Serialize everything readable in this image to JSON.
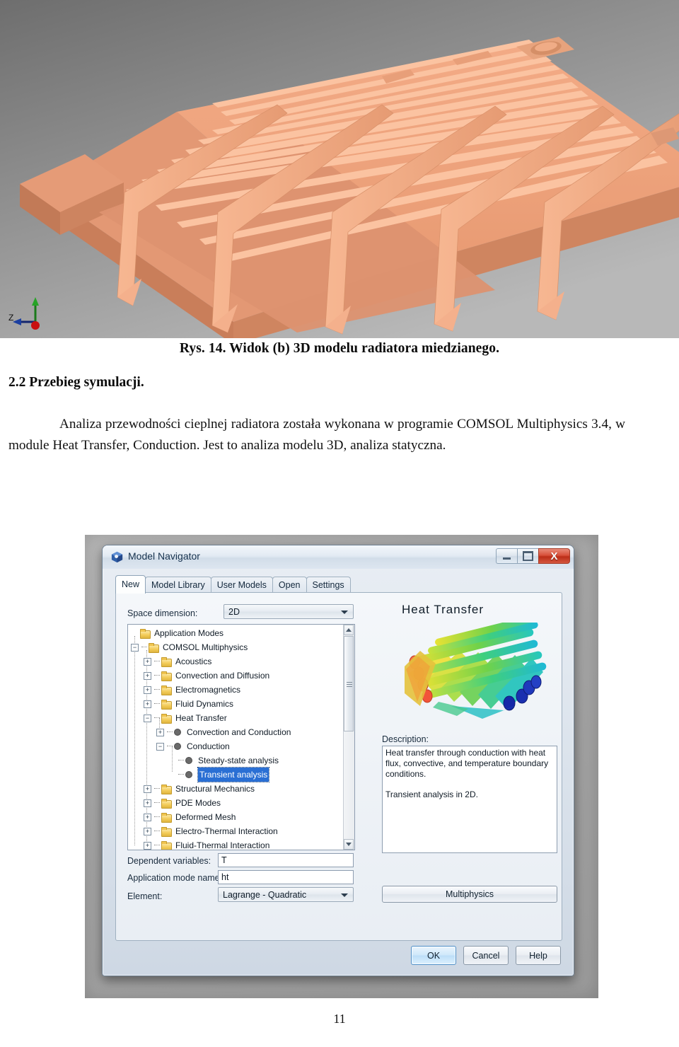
{
  "figure": {
    "alt": "3D model of a copper heatsink rendered in CAD, orange-copper colored, gray gradient background",
    "axis_labels": {
      "z": "Z"
    },
    "colors": {
      "body": "#e0906b",
      "top": "#f0a07a",
      "background_dark": "#6d6d6d",
      "background_light": "#b5b5b5"
    }
  },
  "document": {
    "figure_caption": "Rys. 14. Widok (b) 3D modelu radiatora miedzianego.",
    "section_heading": "2.2 Przebieg symulacji.",
    "paragraph": "Analiza przewodności cieplnej radiatora została wykonana w programie COMSOL Multiphysics 3.4, w module Heat Transfer, Conduction. Jest to analiza modelu 3D, analiza statyczna.",
    "page_number": "11"
  },
  "dialog": {
    "title": "Model Navigator",
    "window_buttons": {
      "minimize": "minimize",
      "maximize": "maximize",
      "close": "X"
    },
    "tabs": [
      {
        "label": "New",
        "active": true
      },
      {
        "label": "Model Library",
        "active": false
      },
      {
        "label": "User Models",
        "active": false
      },
      {
        "label": "Open",
        "active": false
      },
      {
        "label": "Settings",
        "active": false
      }
    ],
    "space_dimension": {
      "label": "Space dimension:",
      "value": "2D"
    },
    "tree": [
      {
        "label": "Application Modes",
        "depth": 0,
        "icon": "folder",
        "expander": "none",
        "selected": false
      },
      {
        "label": "COMSOL Multiphysics",
        "depth": 1,
        "icon": "folder",
        "expander": "minus",
        "selected": false
      },
      {
        "label": "Acoustics",
        "depth": 2,
        "icon": "folder",
        "expander": "plus",
        "selected": false
      },
      {
        "label": "Convection and Diffusion",
        "depth": 2,
        "icon": "folder",
        "expander": "plus",
        "selected": false
      },
      {
        "label": "Electromagnetics",
        "depth": 2,
        "icon": "folder",
        "expander": "plus",
        "selected": false
      },
      {
        "label": "Fluid Dynamics",
        "depth": 2,
        "icon": "folder",
        "expander": "plus",
        "selected": false
      },
      {
        "label": "Heat Transfer",
        "depth": 2,
        "icon": "folder",
        "expander": "minus",
        "selected": false
      },
      {
        "label": "Convection and Conduction",
        "depth": 3,
        "icon": "dot",
        "expander": "plus",
        "selected": false
      },
      {
        "label": "Conduction",
        "depth": 3,
        "icon": "dot",
        "expander": "minus",
        "selected": false
      },
      {
        "label": "Steady-state analysis",
        "depth": 4,
        "icon": "dot",
        "expander": "none",
        "selected": false
      },
      {
        "label": "Transient analysis",
        "depth": 4,
        "icon": "dot",
        "expander": "none",
        "selected": true
      },
      {
        "label": "Structural Mechanics",
        "depth": 2,
        "icon": "folder",
        "expander": "plus",
        "selected": false
      },
      {
        "label": "PDE Modes",
        "depth": 2,
        "icon": "folder",
        "expander": "plus",
        "selected": false
      },
      {
        "label": "Deformed Mesh",
        "depth": 2,
        "icon": "folder",
        "expander": "plus",
        "selected": false
      },
      {
        "label": "Electro-Thermal Interaction",
        "depth": 2,
        "icon": "folder",
        "expander": "plus",
        "selected": false
      },
      {
        "label": "Fluid-Thermal Interaction",
        "depth": 2,
        "icon": "folder",
        "expander": "plus",
        "selected": false
      }
    ],
    "fields": {
      "dependent_variables_label": "Dependent variables:",
      "dependent_variables_value": "T",
      "application_mode_name_label": "Application mode name:",
      "application_mode_name_value": "ht",
      "element_label": "Element:",
      "element_value": "Lagrange - Quadratic"
    },
    "preview": {
      "title": "Heat Transfer",
      "image_alt": "Rainbow-colored 3D heat transfer simulation result showing tubes in a heat exchanger"
    },
    "description": {
      "label": "Description:",
      "line1": "Heat transfer through conduction with heat flux, convective, and temperature boundary conditions.",
      "line2": "Transient analysis in 2D."
    },
    "multiphysics_button": "Multiphysics",
    "footer_buttons": [
      {
        "label": "OK",
        "default": true
      },
      {
        "label": "Cancel",
        "default": false
      },
      {
        "label": "Help",
        "default": false
      }
    ],
    "colors": {
      "selection": "#2a6fd4",
      "close_button": "#bc2e18",
      "default_button": "#bcdef8"
    }
  }
}
